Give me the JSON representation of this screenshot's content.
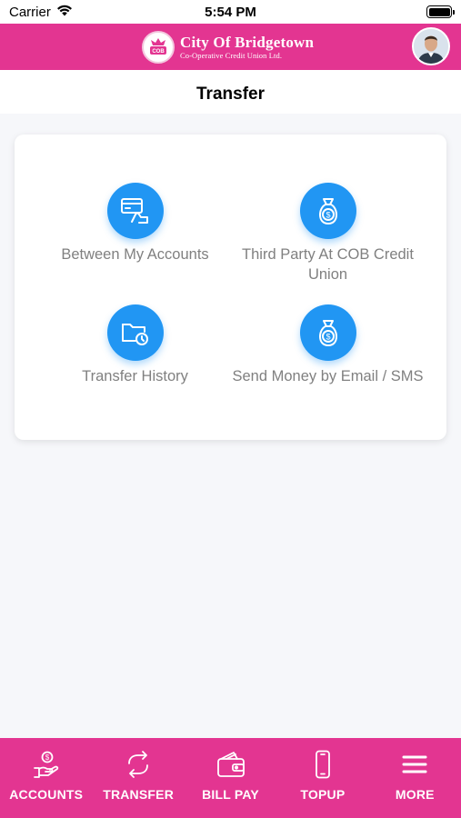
{
  "status_bar": {
    "carrier": "Carrier",
    "time": "5:54 PM",
    "icons": [
      "wifi-icon",
      "battery-icon"
    ]
  },
  "header": {
    "brand_line1": "City Of Bridgetown",
    "brand_line2": "Co-Operative Credit Union Ltd.",
    "seal_text": "C.O.B",
    "accent_color": "#e33591"
  },
  "page": {
    "title": "Transfer"
  },
  "options": [
    {
      "label": "Between My Accounts",
      "icon": "card-hand-icon"
    },
    {
      "label": "Third Party At COB Credit Union",
      "icon": "money-bag-icon"
    },
    {
      "label": "Transfer History",
      "icon": "folder-clock-icon"
    },
    {
      "label": "Send Money by Email / SMS",
      "icon": "money-bag-icon"
    }
  ],
  "option_icon_color": "#2196f3",
  "nav": [
    {
      "label": "ACCOUNTS",
      "icon": "hand-coin-icon"
    },
    {
      "label": "TRANSFER",
      "icon": "transfer-arrows-icon"
    },
    {
      "label": "BILL PAY",
      "icon": "bill-wallet-icon"
    },
    {
      "label": "TOPUP",
      "icon": "phone-icon"
    },
    {
      "label": "MORE",
      "icon": "menu-icon"
    }
  ]
}
